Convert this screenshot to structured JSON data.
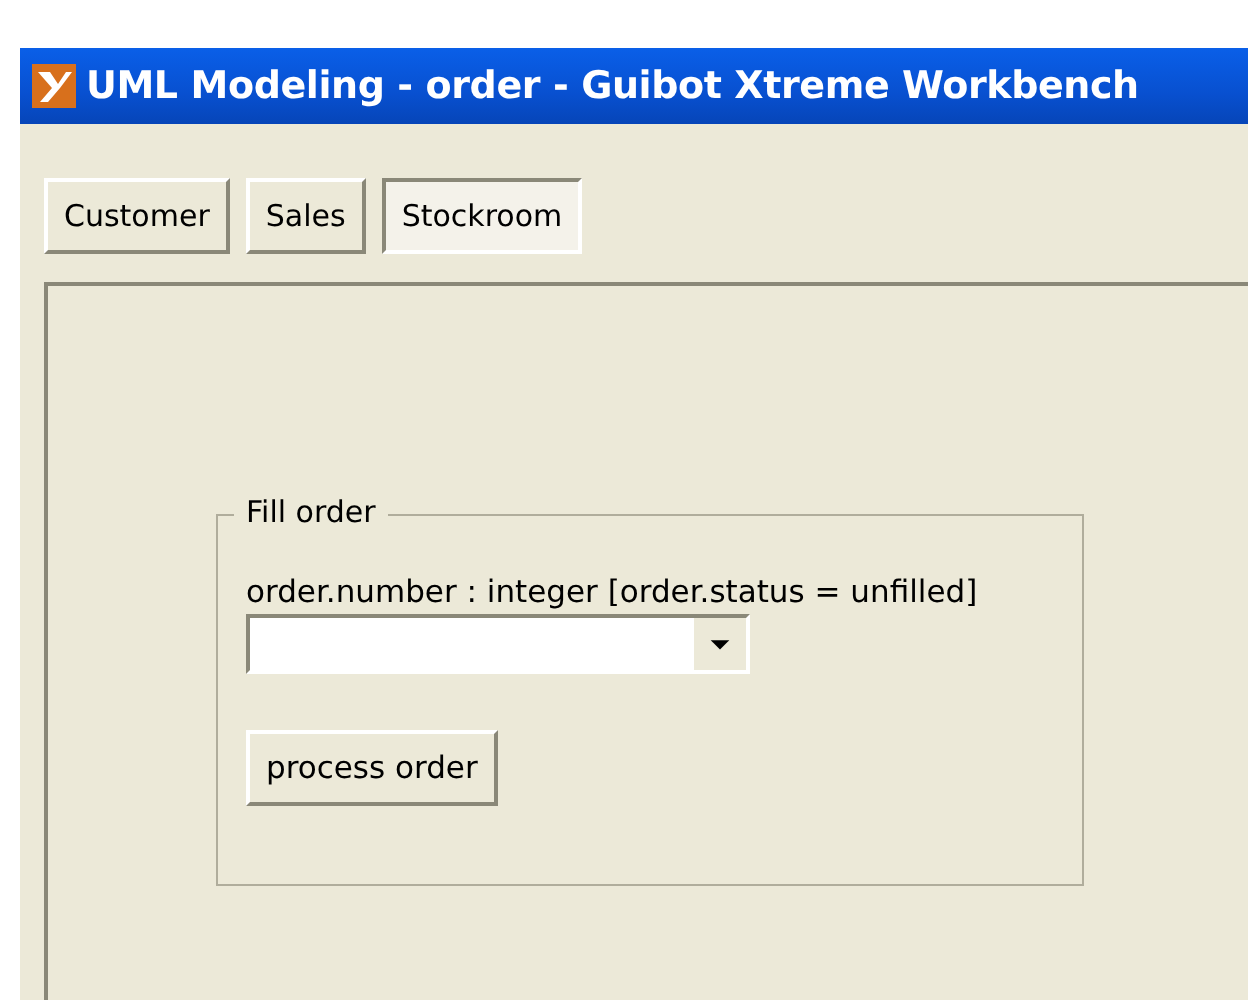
{
  "window": {
    "title": "UML Modeling - order - Guibot Xtreme Workbench"
  },
  "tabs": [
    {
      "label": "Customer",
      "selected": false
    },
    {
      "label": "Sales",
      "selected": false
    },
    {
      "label": "Stockroom",
      "selected": true
    }
  ],
  "group": {
    "title": "Fill order",
    "field_label": "order.number : integer [order.status = unfilled]",
    "button": "process order"
  }
}
